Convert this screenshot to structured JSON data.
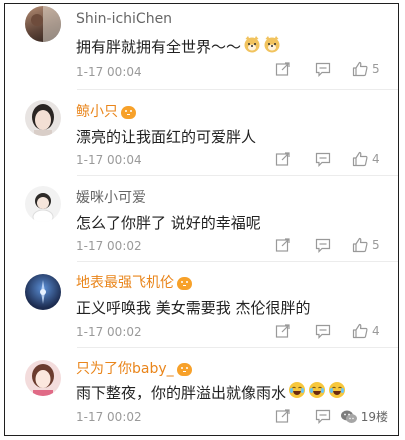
{
  "comments": [
    {
      "name": "Shin-ichiChen",
      "text": "拥有胖就拥有全世界～～",
      "time": "1-17 00:04",
      "likes": "5",
      "vip": false,
      "emoji": [
        "doge-icon",
        "doge-icon"
      ]
    },
    {
      "name": "鲸小只",
      "text": "漂亮的让我面红的可爱胖人",
      "time": "1-17 00:04",
      "likes": "4",
      "vip": true,
      "emoji": []
    },
    {
      "name": "媛咪小可爱",
      "text": "怎么了你胖了 说好的幸福呢",
      "time": "1-17 00:02",
      "likes": "5",
      "vip": false,
      "emoji": []
    },
    {
      "name": "地表最强飞机伦",
      "text": "正义呼唤我 美女需要我 杰伦很胖的",
      "time": "1-17 00:02",
      "likes": "4",
      "vip": true,
      "emoji": []
    },
    {
      "name": "只为了你baby_",
      "text": "雨下整夜，你的胖溢出就像雨水",
      "time": "1-17 00:02",
      "likes": "",
      "vip": true,
      "emoji": [
        "laugh-cry-icon",
        "laugh-cry-icon",
        "laugh-cry-icon"
      ]
    }
  ],
  "watermark": "19楼",
  "colors": {
    "vip_name": "#e9851b",
    "plain_name": "#666666",
    "meta": "#9a9a9a"
  }
}
